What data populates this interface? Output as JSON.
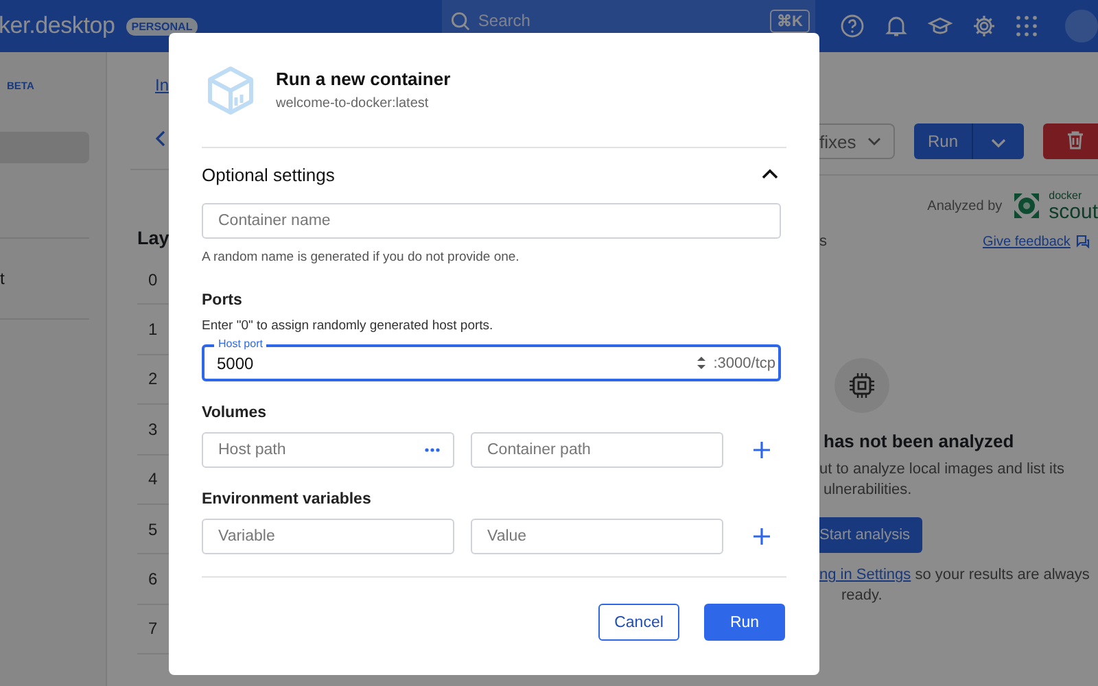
{
  "app_header": {
    "logo": "ker.desktop",
    "plan_badge": "PERSONAL",
    "search": {
      "placeholder": "Search"
    },
    "shortcut": "⌘K"
  },
  "sidebar": {
    "beta_badge": "BETA",
    "items": [
      {
        "selected": true
      },
      {
        "label": "t",
        "selected": false
      }
    ]
  },
  "image_view": {
    "breadcrumb_link": "In",
    "layers_heading": "Lay",
    "layer_numbers": [
      "0",
      "1",
      "2",
      "3",
      "4",
      "5",
      "6",
      "7"
    ],
    "fix_dropdown": "fixes",
    "run_button": "Run",
    "analyzed_by": "Analyzed by",
    "scout_logo": {
      "top": "docker",
      "bottom": "scout"
    },
    "cut_label": "s",
    "feedback_link": "Give feedback",
    "empty_state": {
      "title": "has not been analyzed",
      "description_lines": [
        "ut to analyze local images and list its",
        "ulnerabilities."
      ],
      "button": "Start analysis",
      "settings_link": "ng in Settings",
      "settings_text": "so your results are always",
      "settings_text_end": "ready."
    }
  },
  "dialog": {
    "title": "Run a new container",
    "subtitle": "welcome-to-docker:latest",
    "section": {
      "label": "Optional settings",
      "expanded": true
    },
    "container_name": {
      "placeholder": "Container name",
      "helper": "A random name is generated if you do not provide one."
    },
    "ports": {
      "heading": "Ports",
      "hint": "Enter \"0\" to assign randomly generated host ports.",
      "field_label": "Host port",
      "value": "5000",
      "container_port": ":3000/tcp"
    },
    "volumes": {
      "heading": "Volumes",
      "fields": [
        {
          "placeholder": "Host path",
          "kind": "browse"
        },
        {
          "placeholder": "Container path",
          "kind": "text"
        }
      ]
    },
    "environment": {
      "heading": "Environment variables",
      "fields": [
        {
          "placeholder": "Variable",
          "kind": "text"
        },
        {
          "placeholder": "Value",
          "kind": "text"
        }
      ]
    },
    "buttons": [
      {
        "label": "Cancel",
        "kind": "secondary"
      },
      {
        "label": "Run",
        "kind": "primary"
      }
    ]
  }
}
